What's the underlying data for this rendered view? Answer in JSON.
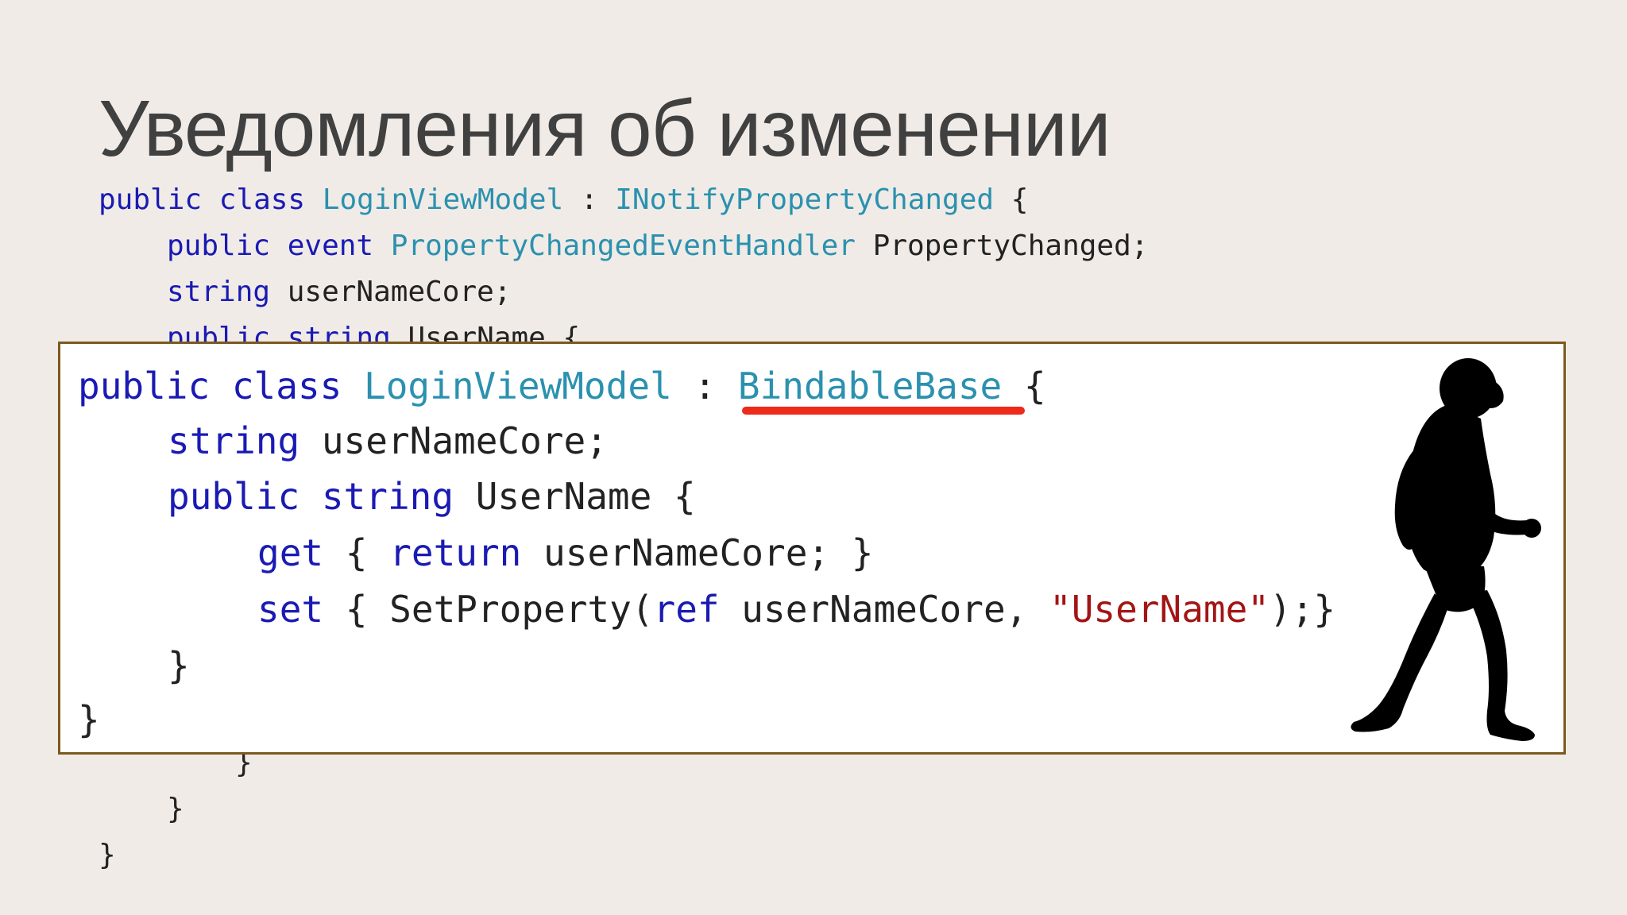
{
  "slide": {
    "title": "Уведомления об изменении"
  },
  "background_code": {
    "line1": {
      "kw": "public class",
      "type1": "LoginViewModel",
      "colon": " : ",
      "type2": "INotifyPropertyChanged",
      "rest": " {"
    },
    "line2": {
      "kw": "public event",
      "type": "PropertyChangedEventHandler",
      "rest": " PropertyChanged;"
    },
    "line3": {
      "kw": "string",
      "rest": " userNameCore;"
    },
    "line4_partial": {
      "kw": "public string",
      "rest": " UserName {"
    },
    "line_close_inner": "}",
    "line_close_mid": "}",
    "line_close_outer": "}"
  },
  "overlay_code": {
    "line1": {
      "kw": "public class",
      "type1": "LoginViewModel",
      "colon": " : ",
      "type2": "BindableBase",
      "rest": " {"
    },
    "line2": {
      "kw": "string",
      "rest": " userNameCore;"
    },
    "line3": {
      "kw": "public string",
      "rest": " UserName {"
    },
    "line4": {
      "kw1": "get",
      "mid": " { ",
      "kw2": "return",
      "rest": " userNameCore; }"
    },
    "line5": {
      "kw1": "set",
      "mid": " { SetProperty(",
      "kw2": "ref",
      "mid2": " userNameCore, ",
      "str": "\"UserName\"",
      "rest": ");}"
    },
    "line6": "}",
    "line7": "}"
  },
  "colors": {
    "background": "#f0ebe6",
    "keyword": "#1a1ab4",
    "type": "#2b91af",
    "string": "#a31515",
    "underline": "#ee2a1a",
    "frame_border": "#7b5a1e"
  },
  "icons": {
    "figure": "walking-hominid-silhouette"
  }
}
